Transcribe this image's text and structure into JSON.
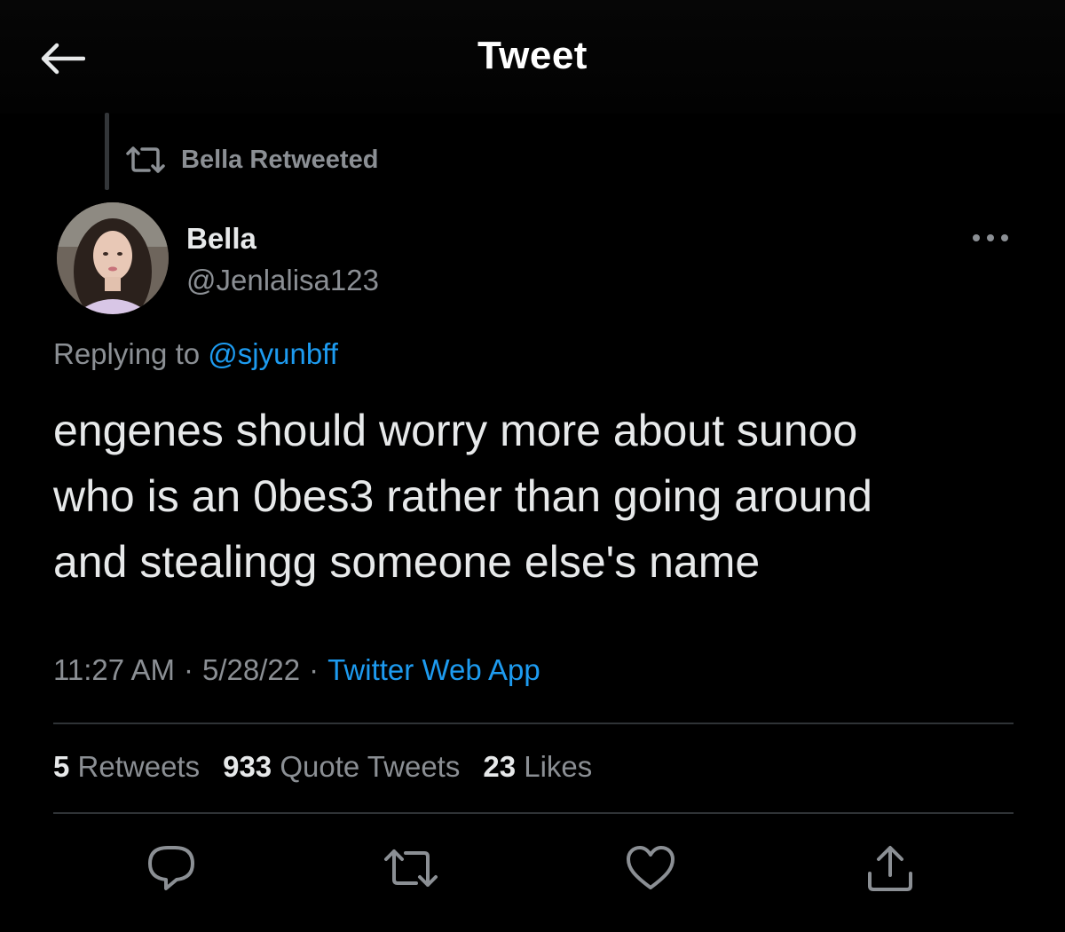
{
  "header": {
    "title": "Tweet"
  },
  "retweet_context": {
    "label": "Bella Retweeted"
  },
  "author": {
    "name": "Bella",
    "handle": "@Jenlalisa123"
  },
  "reply": {
    "prefix": "Replying to",
    "mention": "@sjyunbff"
  },
  "tweet": {
    "lines": [
      "engenes should worry more about sunoo",
      "who is an 0bes3 rather than going around",
      "and stealingg someone else's name"
    ]
  },
  "meta": {
    "time": "11:27 AM",
    "separator": "·",
    "date": "5/28/22",
    "source": "Twitter Web App"
  },
  "stats": {
    "retweets": {
      "count": "5",
      "label": "Retweets"
    },
    "quotes": {
      "count": "933",
      "label": "Quote Tweets"
    },
    "likes": {
      "count": "23",
      "label": "Likes"
    }
  },
  "icons": {
    "back": "arrow-left-icon",
    "retweet": "retweet-icon",
    "more": "more-icon",
    "reply": "reply-icon",
    "like": "heart-icon",
    "share": "share-icon"
  },
  "colors": {
    "accent": "#1d9bf0",
    "muted": "#8b8f94",
    "text": "#e7e9ea",
    "background": "#000000"
  }
}
